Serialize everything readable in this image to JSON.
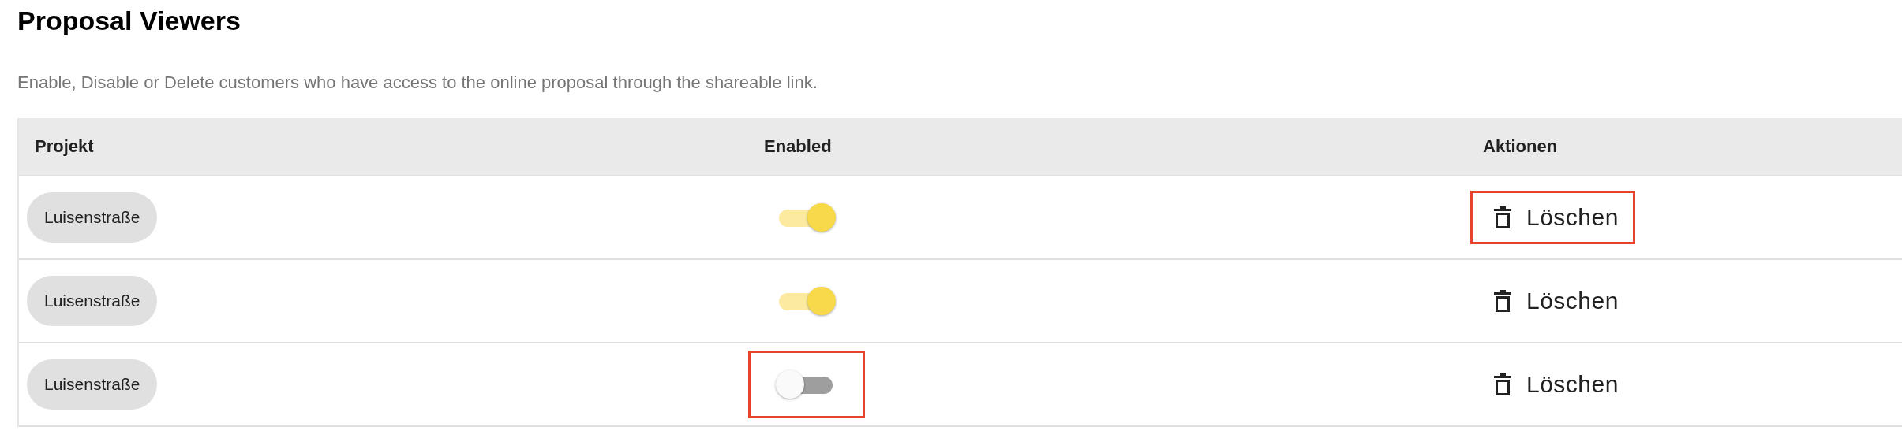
{
  "title": "Proposal Viewers",
  "description": "Enable, Disable or Delete customers who have access to the online proposal through the shareable link.",
  "table": {
    "columns": [
      "Projekt",
      "Enabled",
      "Aktionen"
    ],
    "rows": [
      {
        "project": "Luisenstraße",
        "enabled": true,
        "toggle_highlighted": false,
        "action": "Löschen",
        "action_highlighted": true
      },
      {
        "project": "Luisenstraße",
        "enabled": true,
        "toggle_highlighted": false,
        "action": "Löschen",
        "action_highlighted": false
      },
      {
        "project": "Luisenstraße",
        "enabled": false,
        "toggle_highlighted": true,
        "action": "Löschen",
        "action_highlighted": false
      }
    ]
  }
}
